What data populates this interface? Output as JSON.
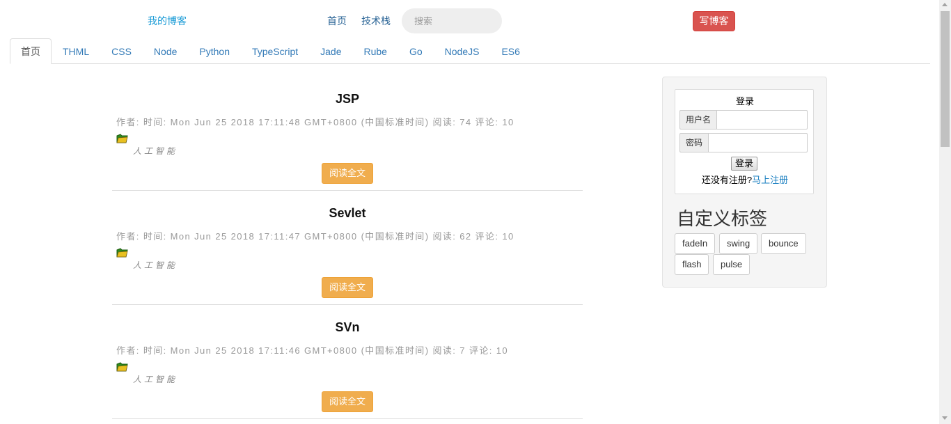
{
  "header": {
    "brand": "我的博客",
    "nav": [
      "首页",
      "技术栈"
    ],
    "search_placeholder": "搜索",
    "write_button": "写博客"
  },
  "tabs": [
    "首页",
    "THML",
    "CSS",
    "Node",
    "Python",
    "TypeScript",
    "Jade",
    "Rube",
    "Go",
    "NodeJS",
    "ES6"
  ],
  "articles": [
    {
      "title": "JSP",
      "meta": "作者: 时间: Mon Jun 25 2018 17:11:48 GMT+0800 (中国标准时间) 阅读: 74 评论: 10",
      "tag": "人工智能",
      "read_label": "阅读全文"
    },
    {
      "title": "Sevlet",
      "meta": "作者: 时间: Mon Jun 25 2018 17:11:47 GMT+0800 (中国标准时间) 阅读: 62 评论: 10",
      "tag": "人工智能",
      "read_label": "阅读全文"
    },
    {
      "title": "SVn",
      "meta": "作者: 时间: Mon Jun 25 2018 17:11:46 GMT+0800 (中国标准时间) 阅读: 7 评论: 10",
      "tag": "人工智能",
      "read_label": "阅读全文"
    }
  ],
  "login": {
    "title": "登录",
    "username_label": "用户名",
    "password_label": "密码",
    "submit": "登录",
    "register_prompt": "还没有注册?",
    "register_link": "马上注册"
  },
  "custom_tags": {
    "title": "自定义标签",
    "tags": [
      "fadeIn",
      "swing",
      "bounce",
      "flash",
      "pulse"
    ]
  },
  "colors": {
    "brand": "#1a9bd6",
    "write_button": "#d9534f",
    "read_button": "#f0ad4e",
    "link": "#337ab7"
  },
  "icons": {
    "article_category": "folder-icon"
  }
}
